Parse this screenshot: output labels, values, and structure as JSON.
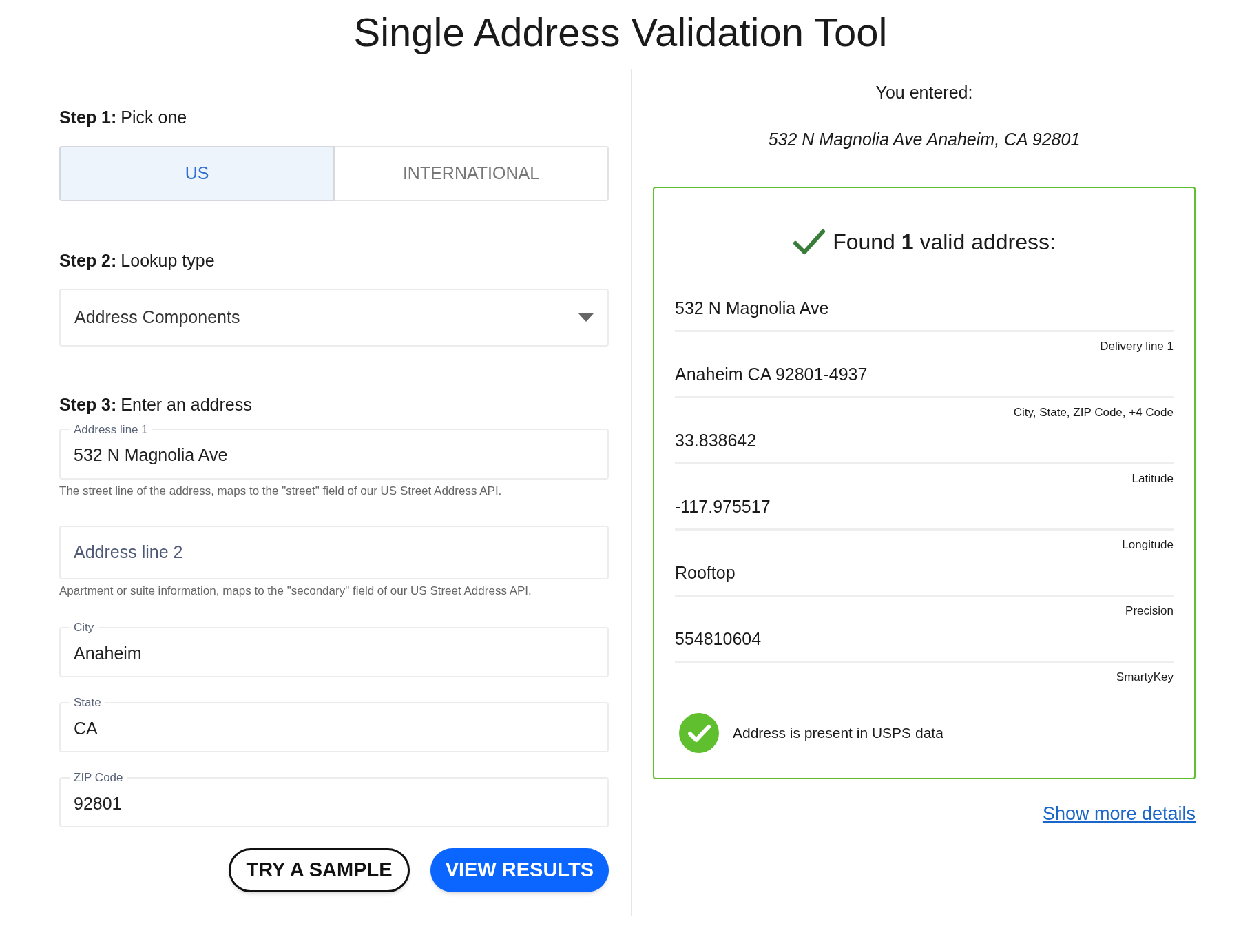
{
  "title": "Single Address Validation Tool",
  "steps": [
    {
      "number": "Step 1:",
      "label": "Pick one"
    },
    {
      "number": "Step 2:",
      "label": "Lookup type"
    },
    {
      "number": "Step 3:",
      "label": "Enter an address"
    }
  ],
  "tabs": [
    {
      "label": "US",
      "selected": true
    },
    {
      "label": "INTERNATIONAL",
      "selected": false
    }
  ],
  "lookup_select": {
    "value": "Address Components"
  },
  "fields": [
    {
      "label": "Address line 1",
      "value": "532 N Magnolia Ave",
      "helper": "The street line of the address, maps to the \"street\" field of our US Street Address API."
    },
    {
      "placeholder": "Address line 2",
      "helper": "Apartment or suite information, maps to the \"secondary\" field of our US Street Address API."
    },
    {
      "label": "City",
      "value": "Anaheim"
    },
    {
      "label": "State",
      "value": "CA"
    },
    {
      "label": "ZIP Code",
      "value": "92801"
    }
  ],
  "buttons": [
    {
      "label": "TRY A SAMPLE",
      "kind": "outline"
    },
    {
      "label": "VIEW RESULTS",
      "kind": "primary"
    }
  ],
  "entered": {
    "label": "You entered:",
    "address": "532 N Magnolia Ave Anaheim, CA 92801"
  },
  "result": {
    "heading": "Found **1** valid address:",
    "rows": [
      {
        "value": "532 N Magnolia Ave",
        "label": "Delivery line 1"
      },
      {
        "value": "Anaheim CA 92801-4937",
        "label": "City, State, ZIP Code, +4 Code"
      },
      {
        "value": "33.838642",
        "label": "Latitude"
      },
      {
        "value": "-117.975517",
        "label": "Longitude"
      },
      {
        "value": "Rooftop",
        "label": "Precision"
      },
      {
        "value": "554810604",
        "label": "SmartyKey"
      }
    ],
    "usps": {
      "text": "Address is present in USPS data"
    }
  },
  "details_link": "Show more details"
}
